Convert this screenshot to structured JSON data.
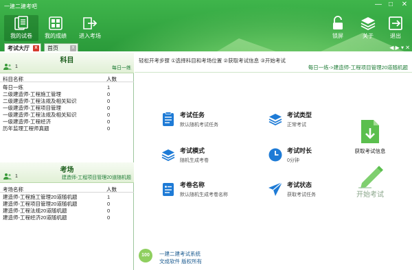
{
  "window": {
    "title": "一建二建考吧",
    "min": "—",
    "max": "□",
    "close": "✕"
  },
  "toolbar": {
    "left_buttons": [
      {
        "label": "我的试卷",
        "icon": "paper-stack-icon"
      },
      {
        "label": "我的成绩",
        "icon": "scores-grid-icon"
      },
      {
        "label": "进入考场",
        "icon": "enter-room-icon"
      }
    ],
    "right_buttons": [
      {
        "label": "锁屏",
        "icon": "lock-icon"
      },
      {
        "label": "关于",
        "icon": "layers-icon"
      },
      {
        "label": "退出",
        "icon": "exit-icon"
      }
    ]
  },
  "tabs": [
    {
      "label": "考试大厅",
      "close": "x"
    },
    {
      "label": "首页",
      "close": "x"
    }
  ],
  "tab_arrows": "◀ ▶ ▾ ✕",
  "subjects": {
    "title": "科目",
    "count": "1",
    "info": "每日一练",
    "col_name": "科目名称",
    "col_count": "人数",
    "rows": [
      {
        "name": "每日一练",
        "count": "1"
      },
      {
        "name": "二级建造师-工程施工管理",
        "count": "0"
      },
      {
        "name": "二级建造师-工程法规及相关知识",
        "count": "0"
      },
      {
        "name": "一级建造师-工程项目管理",
        "count": "0"
      },
      {
        "name": "一级建造师-工程法规及相关知识",
        "count": "0"
      },
      {
        "name": "一级建造师-工程经济",
        "count": "0"
      },
      {
        "name": "历年监理工程师真题",
        "count": "0"
      }
    ]
  },
  "rooms": {
    "title": "考场",
    "count": "1",
    "info": "建造师-工程项目管理20道随机题",
    "col_name": "考场名称",
    "col_count": "人数",
    "rows": [
      {
        "name": "建造师-工程施工管理20道随机题",
        "count": "1"
      },
      {
        "name": "建造师-工程项目管理20道随机题",
        "count": "0"
      },
      {
        "name": "建造师-工程法规20道随机题",
        "count": "0"
      },
      {
        "name": "建造师-工程经济20道随机题",
        "count": "0"
      }
    ]
  },
  "main": {
    "steps": "轻松开考步骤  ①选择科目和考场位置  ②获取考试信息  ③开始考试",
    "breadcrumb": "每日一练->建造师-工程项目管理20道随机题",
    "items": [
      {
        "label": "考试任务",
        "value": "默认随机考试任务",
        "icon": "task-list-icon"
      },
      {
        "label": "考试类型",
        "value": "正常考试",
        "icon": "layers-icon"
      },
      {
        "label": "考试模式",
        "value": "随机生成考卷",
        "icon": "layers-icon"
      },
      {
        "label": "考试时长",
        "value": "0分钟",
        "icon": "clock-icon"
      },
      {
        "label": "考卷名称",
        "value": "默认随机生成考卷名称",
        "icon": "document-icon"
      },
      {
        "label": "考试状态",
        "value": "获取考试任务",
        "icon": "paper-plane-icon"
      }
    ],
    "get_info_label": "获取考试信息",
    "start_label": "开始考试"
  },
  "footer": {
    "logo": "100",
    "line1": "一建二建考试系统",
    "line2": "文成软件  版权所有"
  },
  "colors": {
    "brand_green": "#2a9a3a",
    "accent_blue": "#1e7bd6",
    "danger_red": "#d63b2e"
  }
}
